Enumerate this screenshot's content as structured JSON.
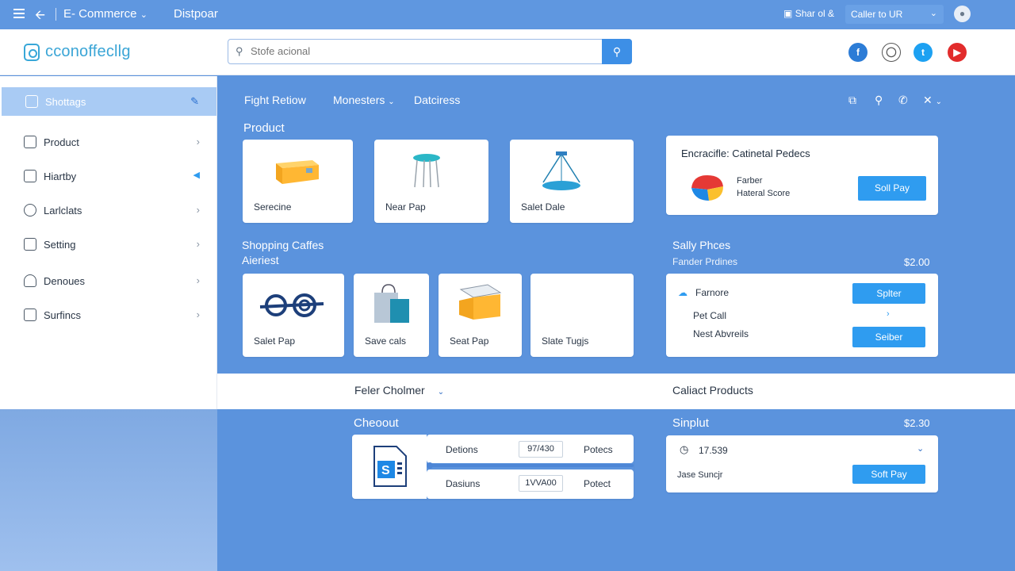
{
  "topbar": {
    "brand": "E- Commerce",
    "page": "Distpoar",
    "right_label": "Shar ol &",
    "select_value": "Caller to UR"
  },
  "header": {
    "logo": "cconoffecllg",
    "search_placeholder": "Stofe acional"
  },
  "sidebar": {
    "items": [
      {
        "label": "Shottags"
      },
      {
        "label": "Product"
      },
      {
        "label": "Hiartby"
      },
      {
        "label": "Larlclats"
      },
      {
        "label": "Setting"
      },
      {
        "label": "Denoues"
      },
      {
        "label": "Surfincs"
      }
    ]
  },
  "main": {
    "tabs": [
      "Fight Retiow",
      "Monesters",
      "Datciress"
    ],
    "product_title": "Product",
    "product_cards": [
      "Serecine",
      "Near Pap",
      "Salet Dale"
    ],
    "shopping_title_1": "Shopping Caffes",
    "shopping_title_2": "Aieriest",
    "shopping_cards": [
      "Salet Pap",
      "Save cals",
      "Seat Pap",
      "Slate Tugjs"
    ],
    "featured": {
      "title": "Encracifle: Catinetal Pedecs",
      "line1": "Farber",
      "line2": "Hateral Score",
      "button": "Soll Pay"
    },
    "sally": {
      "title": "Sally Phces",
      "subtitle": "Fander Prdines",
      "price": "$2.00",
      "row1": "Farnore",
      "row1_button": "Splter",
      "row2": "Pet Call",
      "row3": "Nest Abvreils",
      "row3_button": "Seiber"
    },
    "band": {
      "left": "Feler Cholmer",
      "right": "Caliact Products"
    },
    "checkout": {
      "title": "Cheoout",
      "row1_label": "Detions",
      "row1_value": "97/430",
      "row1_action": "Potecs",
      "row2_label": "Dasiuns",
      "row2_value": "1VVA00",
      "row2_action": "Potect"
    },
    "sinplut": {
      "title": "Sinplut",
      "price": "$2.30",
      "value": "17.539",
      "label": "Jase Suncjr",
      "button": "Soft Pay"
    }
  },
  "colors": {
    "background": "#5b93dd",
    "accent": "#2f9cf0",
    "logo": "#3aa5d6"
  }
}
